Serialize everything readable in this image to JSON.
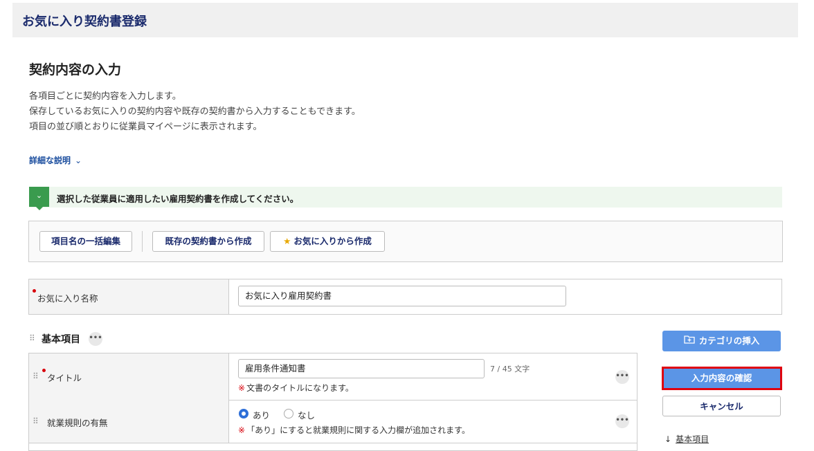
{
  "header": {
    "title": "お気に入り契約書登録"
  },
  "section": {
    "title": "契約内容の入力",
    "description": [
      "各項目ごとに契約内容を入力します。",
      "保存しているお気に入りの契約内容や既存の契約書から入力することもできます。",
      "項目の並び順とおりに従業員マイページに表示されます。"
    ],
    "detail_link": "詳細な説明"
  },
  "notice": {
    "text": "選択した従業員に適用したい雇用契約書を作成してください。"
  },
  "toolbar": {
    "bulk_edit": "項目名の一括編集",
    "from_existing": "既存の契約書から作成",
    "from_favorite": "お気に入りから作成"
  },
  "favorite_name": {
    "label": "お気に入り名称",
    "value": "お気に入り雇用契約書"
  },
  "basic": {
    "title": "基本項目",
    "rows": [
      {
        "label": "タイトル",
        "value": "雇用条件通知書",
        "counter": "7 / 45 文字",
        "note_mark": "※",
        "note": "文書のタイトルになります。"
      },
      {
        "label": "就業規則の有無",
        "option_yes": "あり",
        "option_no": "なし",
        "selected": "あり",
        "note_mark": "※",
        "note": "「あり」にすると就業規則に関する入力欄が追加されます。"
      }
    ]
  },
  "side": {
    "insert_category": "カテゴリの挿入",
    "confirm": "入力内容の確認",
    "cancel": "キャンセル",
    "anchor": "基本項目"
  },
  "colors": {
    "header_text": "#1a2a6c",
    "primary": "#5b95e6",
    "required": "#d8000b",
    "notice_bg": "#eef7ee",
    "notice_accent": "#3a9b4e",
    "highlight": "#e0000e"
  }
}
